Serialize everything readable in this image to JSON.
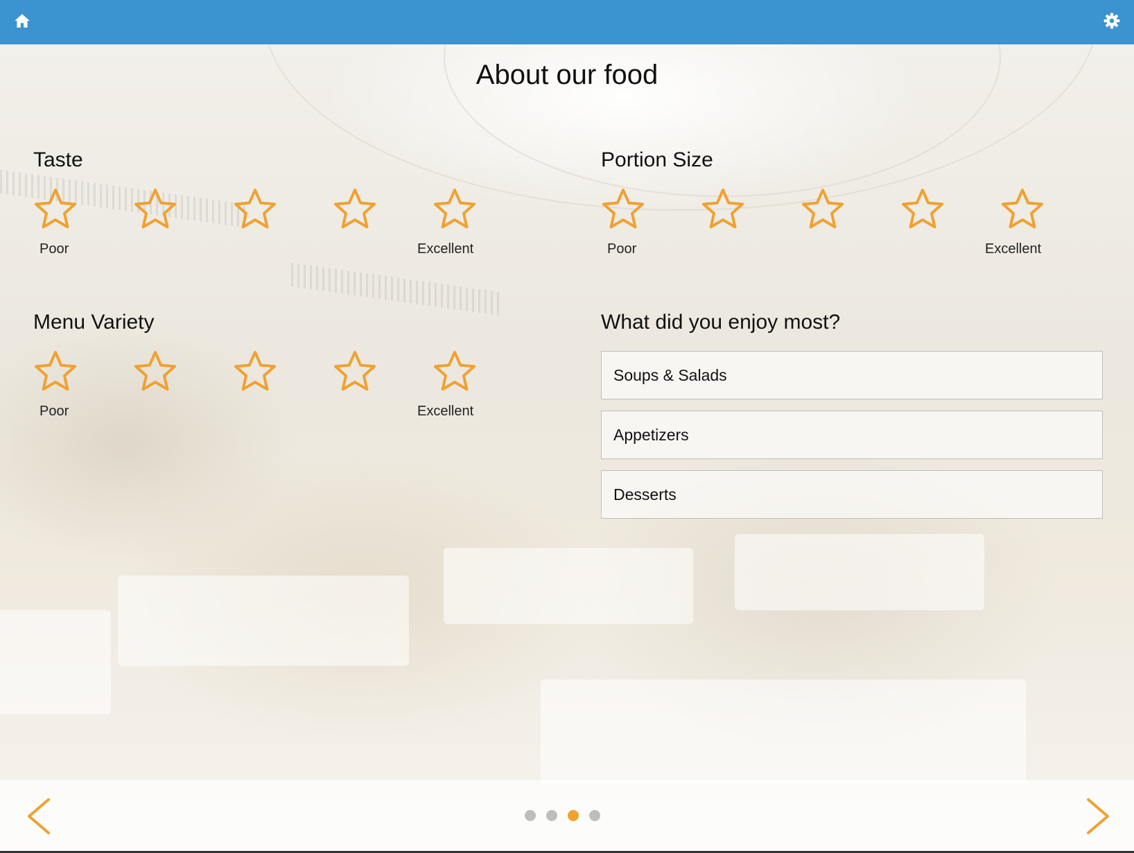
{
  "header": {
    "home_icon": "home-icon",
    "settings_icon": "gear-icon",
    "color": "#3b93d0"
  },
  "page": {
    "title": "About our food"
  },
  "ratings": [
    {
      "label": "Taste",
      "min_label": "Poor",
      "max_label": "Excellent",
      "stars": 5,
      "selected": 0
    },
    {
      "label": "Portion Size",
      "min_label": "Poor",
      "max_label": "Excellent",
      "stars": 5,
      "selected": 0
    },
    {
      "label": "Menu Variety",
      "min_label": "Poor",
      "max_label": "Excellent",
      "stars": 5,
      "selected": 0
    }
  ],
  "enjoy": {
    "label": "What did you enjoy most?",
    "options": [
      "Soups & Salads",
      "Appetizers",
      "Desserts"
    ]
  },
  "pager": {
    "total_pages": 4,
    "current_page": 3,
    "prev_icon": "chevron-left-icon",
    "next_icon": "chevron-right-icon"
  },
  "colors": {
    "accent": "#f0a131",
    "dot_inactive": "#bdbdbd",
    "border": "#bdbdbd"
  }
}
